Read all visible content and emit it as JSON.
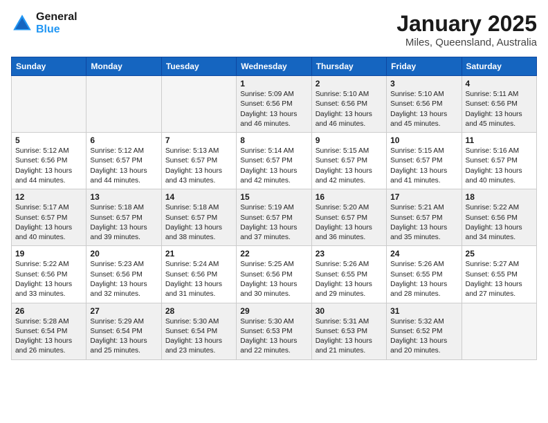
{
  "logo": {
    "line1": "General",
    "line2": "Blue"
  },
  "title": "January 2025",
  "location": "Miles, Queensland, Australia",
  "days_of_week": [
    "Sunday",
    "Monday",
    "Tuesday",
    "Wednesday",
    "Thursday",
    "Friday",
    "Saturday"
  ],
  "weeks": [
    [
      {
        "day": "",
        "empty": true
      },
      {
        "day": "",
        "empty": true
      },
      {
        "day": "",
        "empty": true
      },
      {
        "day": "1",
        "info": "Sunrise: 5:09 AM\nSunset: 6:56 PM\nDaylight: 13 hours\nand 46 minutes."
      },
      {
        "day": "2",
        "info": "Sunrise: 5:10 AM\nSunset: 6:56 PM\nDaylight: 13 hours\nand 46 minutes."
      },
      {
        "day": "3",
        "info": "Sunrise: 5:10 AM\nSunset: 6:56 PM\nDaylight: 13 hours\nand 45 minutes."
      },
      {
        "day": "4",
        "info": "Sunrise: 5:11 AM\nSunset: 6:56 PM\nDaylight: 13 hours\nand 45 minutes."
      }
    ],
    [
      {
        "day": "5",
        "info": "Sunrise: 5:12 AM\nSunset: 6:56 PM\nDaylight: 13 hours\nand 44 minutes."
      },
      {
        "day": "6",
        "info": "Sunrise: 5:12 AM\nSunset: 6:57 PM\nDaylight: 13 hours\nand 44 minutes."
      },
      {
        "day": "7",
        "info": "Sunrise: 5:13 AM\nSunset: 6:57 PM\nDaylight: 13 hours\nand 43 minutes."
      },
      {
        "day": "8",
        "info": "Sunrise: 5:14 AM\nSunset: 6:57 PM\nDaylight: 13 hours\nand 42 minutes."
      },
      {
        "day": "9",
        "info": "Sunrise: 5:15 AM\nSunset: 6:57 PM\nDaylight: 13 hours\nand 42 minutes."
      },
      {
        "day": "10",
        "info": "Sunrise: 5:15 AM\nSunset: 6:57 PM\nDaylight: 13 hours\nand 41 minutes."
      },
      {
        "day": "11",
        "info": "Sunrise: 5:16 AM\nSunset: 6:57 PM\nDaylight: 13 hours\nand 40 minutes."
      }
    ],
    [
      {
        "day": "12",
        "info": "Sunrise: 5:17 AM\nSunset: 6:57 PM\nDaylight: 13 hours\nand 40 minutes."
      },
      {
        "day": "13",
        "info": "Sunrise: 5:18 AM\nSunset: 6:57 PM\nDaylight: 13 hours\nand 39 minutes."
      },
      {
        "day": "14",
        "info": "Sunrise: 5:18 AM\nSunset: 6:57 PM\nDaylight: 13 hours\nand 38 minutes."
      },
      {
        "day": "15",
        "info": "Sunrise: 5:19 AM\nSunset: 6:57 PM\nDaylight: 13 hours\nand 37 minutes."
      },
      {
        "day": "16",
        "info": "Sunrise: 5:20 AM\nSunset: 6:57 PM\nDaylight: 13 hours\nand 36 minutes."
      },
      {
        "day": "17",
        "info": "Sunrise: 5:21 AM\nSunset: 6:57 PM\nDaylight: 13 hours\nand 35 minutes."
      },
      {
        "day": "18",
        "info": "Sunrise: 5:22 AM\nSunset: 6:56 PM\nDaylight: 13 hours\nand 34 minutes."
      }
    ],
    [
      {
        "day": "19",
        "info": "Sunrise: 5:22 AM\nSunset: 6:56 PM\nDaylight: 13 hours\nand 33 minutes."
      },
      {
        "day": "20",
        "info": "Sunrise: 5:23 AM\nSunset: 6:56 PM\nDaylight: 13 hours\nand 32 minutes."
      },
      {
        "day": "21",
        "info": "Sunrise: 5:24 AM\nSunset: 6:56 PM\nDaylight: 13 hours\nand 31 minutes."
      },
      {
        "day": "22",
        "info": "Sunrise: 5:25 AM\nSunset: 6:56 PM\nDaylight: 13 hours\nand 30 minutes."
      },
      {
        "day": "23",
        "info": "Sunrise: 5:26 AM\nSunset: 6:55 PM\nDaylight: 13 hours\nand 29 minutes."
      },
      {
        "day": "24",
        "info": "Sunrise: 5:26 AM\nSunset: 6:55 PM\nDaylight: 13 hours\nand 28 minutes."
      },
      {
        "day": "25",
        "info": "Sunrise: 5:27 AM\nSunset: 6:55 PM\nDaylight: 13 hours\nand 27 minutes."
      }
    ],
    [
      {
        "day": "26",
        "info": "Sunrise: 5:28 AM\nSunset: 6:54 PM\nDaylight: 13 hours\nand 26 minutes."
      },
      {
        "day": "27",
        "info": "Sunrise: 5:29 AM\nSunset: 6:54 PM\nDaylight: 13 hours\nand 25 minutes."
      },
      {
        "day": "28",
        "info": "Sunrise: 5:30 AM\nSunset: 6:54 PM\nDaylight: 13 hours\nand 23 minutes."
      },
      {
        "day": "29",
        "info": "Sunrise: 5:30 AM\nSunset: 6:53 PM\nDaylight: 13 hours\nand 22 minutes."
      },
      {
        "day": "30",
        "info": "Sunrise: 5:31 AM\nSunset: 6:53 PM\nDaylight: 13 hours\nand 21 minutes."
      },
      {
        "day": "31",
        "info": "Sunrise: 5:32 AM\nSunset: 6:52 PM\nDaylight: 13 hours\nand 20 minutes."
      },
      {
        "day": "",
        "empty": true
      }
    ]
  ]
}
